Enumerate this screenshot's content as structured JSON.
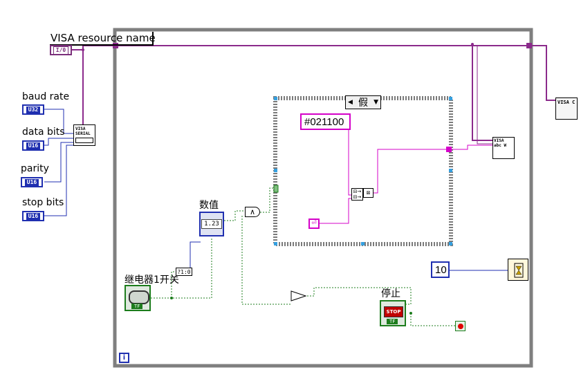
{
  "labels": {
    "visa_resource_name": "VISA resource name",
    "baud_rate": "baud rate",
    "data_bits": "data bits",
    "parity": "parity",
    "stop_bits": "stop bits",
    "value": "数值",
    "relay1_switch": "继电器1开关",
    "stop": "停止"
  },
  "terminals": {
    "visa_type": "I/0",
    "baud_type": "U32",
    "data_bits_type": "U16",
    "parity_type": "U16",
    "stop_bits_type": "U16",
    "numeric_display": "1.23",
    "bool_type": "TF"
  },
  "case_structure": {
    "selector": "假"
  },
  "constants": {
    "command_string": "#021100",
    "wait_ms": "10"
  },
  "nodes": {
    "visa_serial": "VISA SERIAL",
    "visa_write": "VISA abc W",
    "visa_close": "VISA C",
    "bool_to_num": "?1:0",
    "and_op": "∧",
    "not_op": "▷",
    "stop_btn": "STOP",
    "loop_iter": "i"
  },
  "colors": {
    "visa_wire": "#7a2f7a",
    "numeric_wire": "#1f2fb0",
    "bool_wire": "#1c7c1c",
    "string_wire": "#d400c8",
    "loop_frame": "#808080"
  }
}
